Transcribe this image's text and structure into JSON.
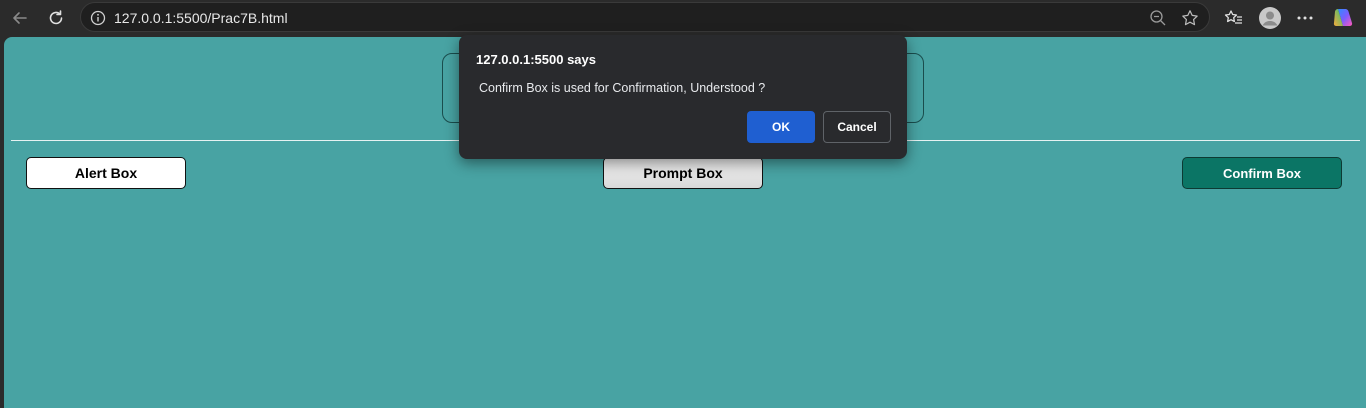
{
  "browser": {
    "url": "127.0.0.1:5500/Prac7B.html",
    "icons": [
      "back-arrow-icon",
      "refresh-icon",
      "info-icon",
      "zoom-out-icon",
      "star-icon",
      "favorites-icon",
      "profile-icon",
      "more-icon",
      "copilot-icon"
    ]
  },
  "page": {
    "background_color": "#48a3a3",
    "buttons": {
      "alert": "Alert Box",
      "prompt": "Prompt Box",
      "confirm": "Confirm Box"
    }
  },
  "dialog": {
    "title": "127.0.0.1:5500 says",
    "message": "Confirm Box is used for Confirmation, Understood ?",
    "ok_label": "OK",
    "cancel_label": "Cancel",
    "ok_color": "#1f5fd1"
  }
}
